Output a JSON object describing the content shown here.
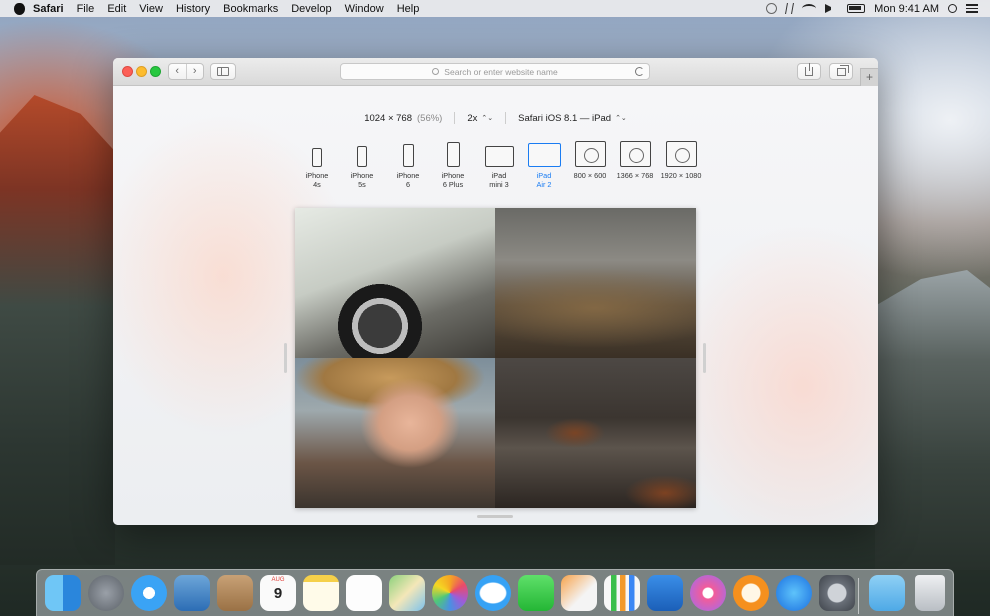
{
  "menubar": {
    "app_name": "Safari",
    "items": [
      "File",
      "Edit",
      "View",
      "History",
      "Bookmarks",
      "Develop",
      "Window",
      "Help"
    ],
    "clock": "Mon 9:41 AM",
    "status_icons": [
      "time-machine-icon",
      "bluetooth-icon",
      "wifi-icon",
      "volume-icon",
      "battery-icon",
      "spotlight-icon",
      "notification-center-icon"
    ]
  },
  "toolbar": {
    "back_glyph": "‹",
    "forward_glyph": "›",
    "address_placeholder": "Search or enter website name",
    "new_tab_glyph": "+"
  },
  "responsive": {
    "resolution": "1024 × 768",
    "scale_percent": "(56%)",
    "pixel_ratio": "2x",
    "user_agent": "Safari iOS 8.1 — iPad",
    "devices": [
      {
        "name": "iPhone\n4s",
        "active": false
      },
      {
        "name": "iPhone\n5s",
        "active": false
      },
      {
        "name": "iPhone\n6",
        "active": false
      },
      {
        "name": "iPhone\n6 Plus",
        "active": false
      },
      {
        "name": "iPad\nmini 3",
        "active": false
      },
      {
        "name": "iPad\nAir 2",
        "active": true
      },
      {
        "name": "800 × 600",
        "active": false
      },
      {
        "name": "1366 × 768",
        "active": false
      },
      {
        "name": "1920 × 1080",
        "active": false
      }
    ]
  },
  "dock": {
    "apps": [
      "Finder",
      "Launchpad",
      "Safari",
      "Mail",
      "Contacts",
      "Calendar",
      "Notes",
      "Reminders",
      "Maps",
      "Photos",
      "Messages",
      "FaceTime",
      "Pages",
      "Numbers",
      "Keynote",
      "iTunes",
      "iBooks",
      "App Store",
      "System Preferences",
      "Downloads",
      "Trash"
    ],
    "calendar_month": "AUG",
    "calendar_day": "9"
  },
  "colors": {
    "accent": "#1a7cf2",
    "close": "#fc5f57",
    "minimize": "#fdbc2e",
    "maximize": "#28c840"
  }
}
